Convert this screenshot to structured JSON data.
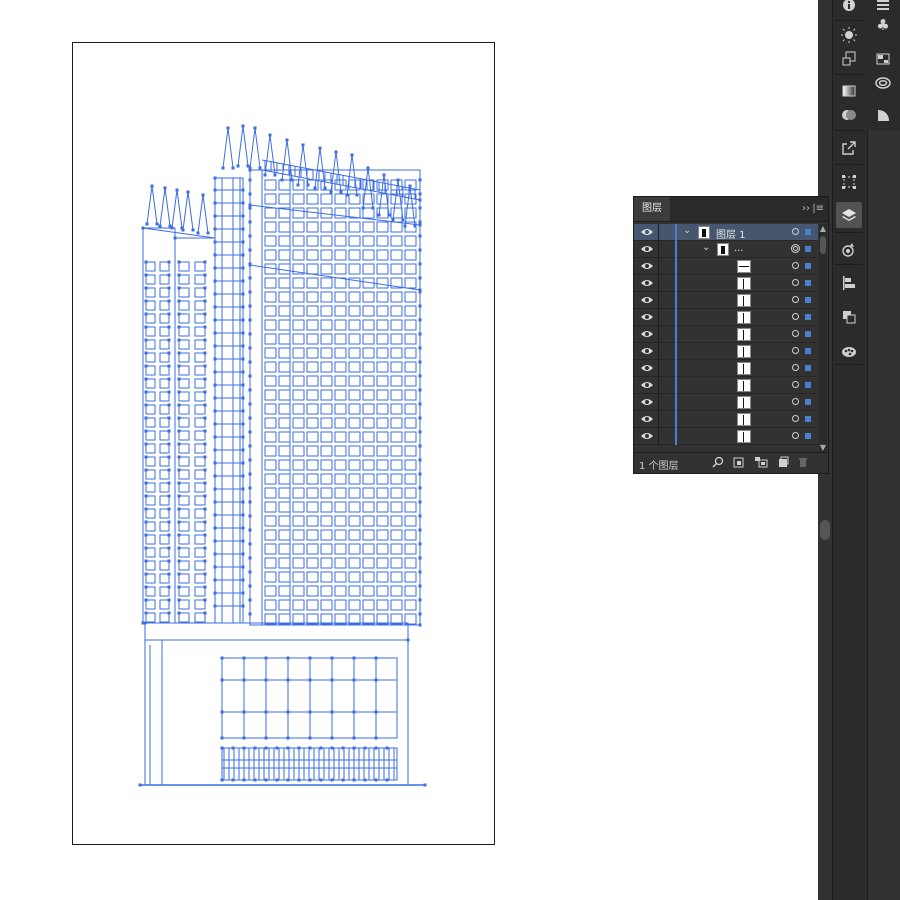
{
  "layers_panel": {
    "tab_label": "图层",
    "collapse_icon": "double-chevron-right-icon",
    "menu_icon": "hamburger-menu-icon",
    "footer_count": "1 个图层",
    "top_layer": {
      "name": "图层 1",
      "expanded": true
    },
    "group_layer": {
      "name": "...",
      "expanded": true
    },
    "sublayer_count": 11,
    "selection_color": "#4a7fd0"
  },
  "footer_icons": [
    "search-icon",
    "collect-export-icon",
    "make-clipping-mask-icon",
    "new-layer-icon",
    "delete-icon"
  ],
  "dock_icons": [
    "info-icon",
    "sun-icon",
    "transform-icon",
    "gradient-icon",
    "transparency-icon",
    "export-icon",
    "artboard-icon",
    "layers-icon",
    "appearance-icon",
    "align-icon",
    "pathfinder-icon",
    "color-guide-icon",
    "menu-icon",
    "club-icon",
    "swatches-icon",
    "cc-libraries-icon",
    "shape-icon"
  ],
  "colors": {
    "artwork_blue": "#3d6de0",
    "panel_bg": "#323232",
    "dock_bg": "#2b2b2b",
    "selected_row": "#46566e"
  }
}
